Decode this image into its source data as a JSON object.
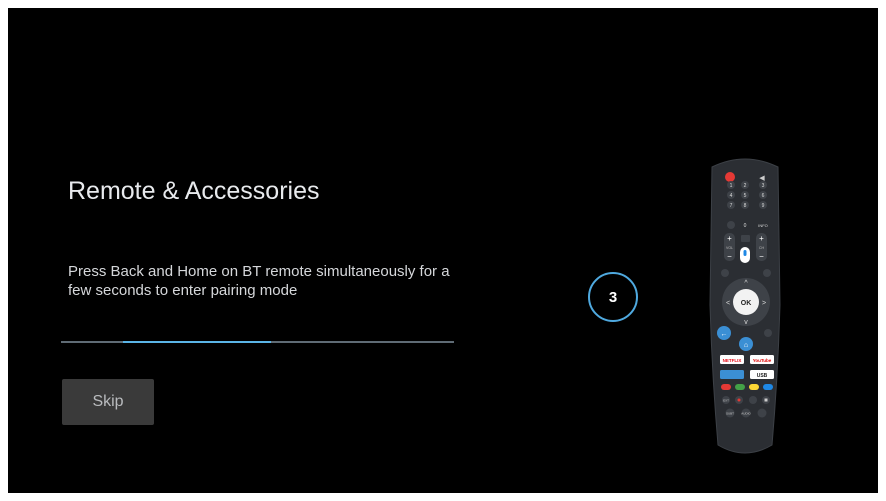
{
  "setup": {
    "title": "Remote & Accessories",
    "instructions": "Press Back and Home on BT remote simultaneously for a few seconds to enter pairing mode",
    "progress": 0.4,
    "skip_label": "Skip",
    "countdown": "3"
  },
  "remote": {
    "number_keys": [
      "1",
      "2",
      "3",
      "4",
      "5",
      "6",
      "7",
      "8",
      "9",
      "0"
    ],
    "info_label": "INFO",
    "vol_label": "VOL",
    "ch_label": "CH",
    "ok_label": "OK",
    "netflix_label": "NETFLIX",
    "youtube_label": "YouTube",
    "usb_label": "USB",
    "ext_label": "EXT",
    "subt_label": "SUBT",
    "audio_label": "AUDIO"
  },
  "colors": {
    "background": "#000000",
    "accent": "#4fa9df",
    "skip_button": "#3a3a3a"
  }
}
